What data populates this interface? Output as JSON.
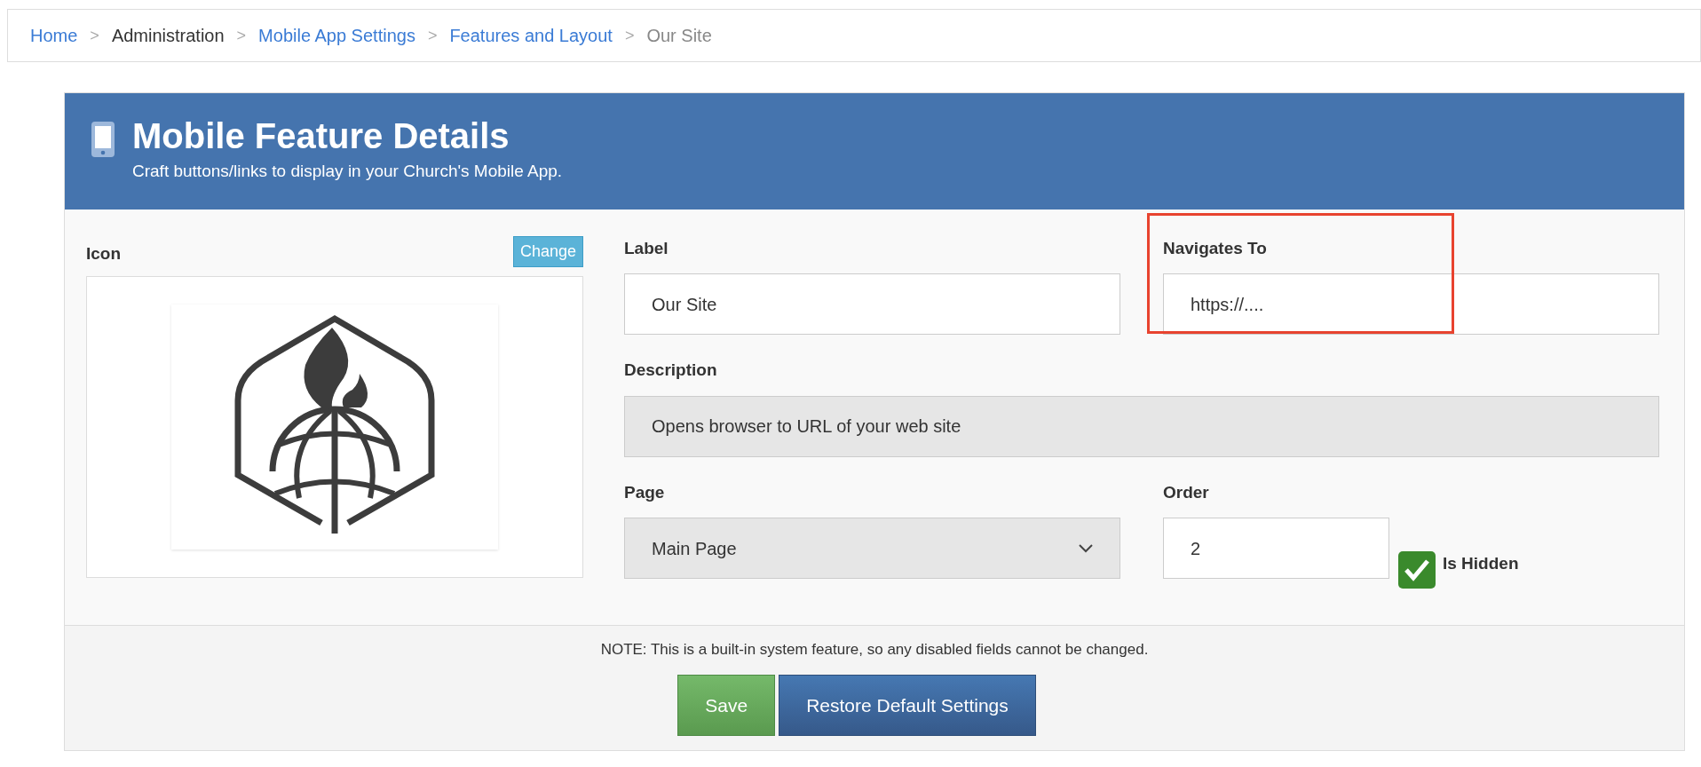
{
  "breadcrumb": [
    {
      "label": "Home",
      "kind": "link"
    },
    {
      "label": "Administration",
      "kind": "text"
    },
    {
      "label": "Mobile App Settings",
      "kind": "link"
    },
    {
      "label": "Features and Layout",
      "kind": "link"
    },
    {
      "label": "Our Site",
      "kind": "current"
    }
  ],
  "breadcrumb_separator": ">",
  "panel": {
    "title": "Mobile Feature Details",
    "subtitle": "Craft buttons/links to display in your Church's Mobile App."
  },
  "icon_section": {
    "label": "Icon",
    "change_button": "Change"
  },
  "fields": [
    {
      "kind": "input",
      "label": "Label",
      "value": "Our Site",
      "disabled": false,
      "highlighted": false
    },
    {
      "kind": "input",
      "label": "Navigates To",
      "value": "https://....",
      "disabled": false,
      "highlighted": true
    },
    {
      "kind": "input",
      "label": "Description",
      "value": "Opens browser to URL of your web site",
      "disabled": true,
      "highlighted": false
    },
    {
      "kind": "select",
      "label": "Page",
      "value": "Main Page",
      "disabled": true,
      "highlighted": false
    },
    {
      "kind": "input",
      "label": "Order",
      "value": "2",
      "disabled": false,
      "highlighted": false
    },
    {
      "kind": "checkbox",
      "label": "Is Hidden",
      "checked": true
    }
  ],
  "footer": {
    "note": "NOTE: This is a built-in system feature, so any disabled fields cannot be changed.",
    "buttons": [
      {
        "label": "Save",
        "kind": "success"
      },
      {
        "label": "Restore Default Settings",
        "kind": "primary"
      }
    ]
  }
}
